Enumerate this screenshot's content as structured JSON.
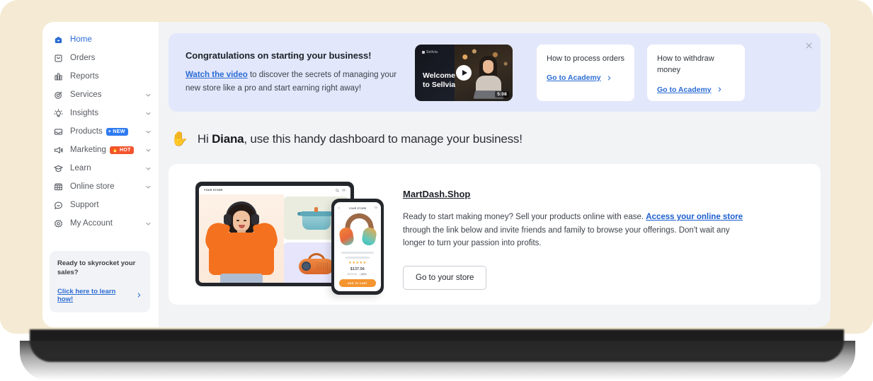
{
  "sidebar": {
    "items": [
      {
        "label": "Home",
        "icon": "home-icon",
        "active": true,
        "chevron": false,
        "badge": null
      },
      {
        "label": "Orders",
        "icon": "orders-icon",
        "active": false,
        "chevron": false,
        "badge": null
      },
      {
        "label": "Reports",
        "icon": "reports-icon",
        "active": false,
        "chevron": false,
        "badge": null
      },
      {
        "label": "Services",
        "icon": "target-icon",
        "active": false,
        "chevron": true,
        "badge": null
      },
      {
        "label": "Insights",
        "icon": "lightbulb-icon",
        "active": false,
        "chevron": true,
        "badge": null
      },
      {
        "label": "Products",
        "icon": "inbox-icon",
        "active": false,
        "chevron": true,
        "badge": {
          "text": "+ NEW",
          "style": "new"
        }
      },
      {
        "label": "Marketing",
        "icon": "megaphone-icon",
        "active": false,
        "chevron": true,
        "badge": {
          "text": "HOT",
          "style": "hot",
          "emoji": "🔥"
        }
      },
      {
        "label": "Learn",
        "icon": "graduation-icon",
        "active": false,
        "chevron": true,
        "badge": null
      },
      {
        "label": "Online store",
        "icon": "storefront-icon",
        "active": false,
        "chevron": true,
        "badge": null
      },
      {
        "label": "Support",
        "icon": "chat-smile-icon",
        "active": false,
        "chevron": false,
        "badge": null
      },
      {
        "label": "My Account",
        "icon": "gear-icon",
        "active": false,
        "chevron": true,
        "badge": null
      }
    ],
    "promo": {
      "title": "Ready to skyrocket your sales?",
      "link": "Click here to learn how!"
    }
  },
  "banner": {
    "title": "Congratulations on starting your business!",
    "link_text": "Watch the video",
    "body_rest": " to discover the secrets of managing your new store like a pro and start earning right away!",
    "close_label": "×",
    "video": {
      "logo": "Sellvia",
      "title_line1": "Welcome",
      "title_line2": "to Sellvia",
      "duration": "5:08"
    },
    "cards": [
      {
        "title": "How to process orders",
        "link": "Go to Academy"
      },
      {
        "title": "How to withdraw money",
        "link": "Go to Academy"
      }
    ]
  },
  "greeting": {
    "emoji": "✋",
    "prefix": "Hi ",
    "name": "Diana",
    "suffix": ", use this handy dashboard to manage your business!"
  },
  "store_card": {
    "name": "MartDash.Shop",
    "desc_part1": "Ready to start making money? Sell your products online with ease. ",
    "desc_link": "Access your online store",
    "desc_part2": " through the link below and invite friends and family to browse your offerings. Don't wait any longer to turn your passion into profits.",
    "button": "Go to your store",
    "illustration": {
      "tablet_logo": "YOUR STORE",
      "phone_logo": "YOUR STORE",
      "stars": "★★★★★",
      "price": "$137.56",
      "old_price": "$229.00",
      "discount": "-40%",
      "cta": "ADD TO CART"
    }
  },
  "colors": {
    "page_bg": "#f5ead3",
    "sidebar_bg": "#ffffff",
    "content_bg": "#f2f3f5",
    "banner_bg": "#e3e7fb",
    "accent_blue": "#2b6cd4",
    "badge_new": "#2f7bf0",
    "badge_hot": "#f2542d",
    "brand_orange": "#f4711f"
  }
}
